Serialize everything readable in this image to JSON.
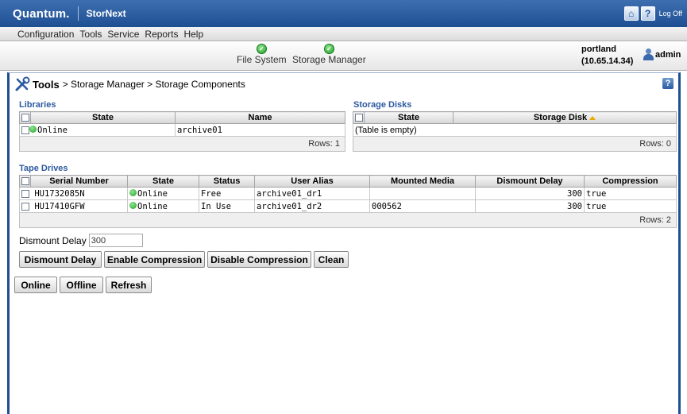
{
  "header": {
    "logo": "Quantum.",
    "product": "StorNext",
    "logoff_label": "Log Off"
  },
  "menu": [
    "Configuration",
    "Tools",
    "Service",
    "Reports",
    "Help"
  ],
  "status": {
    "items": [
      {
        "label": "File System"
      },
      {
        "label": "Storage Manager"
      }
    ],
    "host_name": "portland",
    "host_ip": "(10.65.14.34)",
    "user": "admin"
  },
  "breadcrumb": {
    "root": "Tools",
    "rest": "> Storage Manager > Storage Components"
  },
  "libraries": {
    "title": "Libraries",
    "columns": [
      "State",
      "Name"
    ],
    "rows": [
      {
        "state": "Online",
        "name": "archive01"
      }
    ],
    "footer": "Rows: 1"
  },
  "storage_disks": {
    "title": "Storage Disks",
    "columns": [
      "State",
      "Storage Disk"
    ],
    "empty_text": "(Table is empty)",
    "footer": "Rows: 0"
  },
  "tape_drives": {
    "title": "Tape Drives",
    "columns": [
      "Serial Number",
      "State",
      "Status",
      "User Alias",
      "Mounted Media",
      "Dismount Delay",
      "Compression"
    ],
    "rows": [
      {
        "serial": "HU1732085N",
        "state": "Online",
        "status": "Free",
        "alias": "archive01_dr1",
        "media": "",
        "delay": "300",
        "compression": "true"
      },
      {
        "serial": "HU17410GFW",
        "state": "Online",
        "status": "In Use",
        "alias": "archive01_dr2",
        "media": "000562",
        "delay": "300",
        "compression": "true"
      }
    ],
    "footer": "Rows: 2"
  },
  "dismount_delay": {
    "label": "Dismount Delay",
    "value": "300"
  },
  "actions": {
    "dismount_delay": "Dismount Delay",
    "enable_compression": "Enable Compression",
    "disable_compression": "Disable Compression",
    "clean": "Clean",
    "online": "Online",
    "offline": "Offline",
    "refresh": "Refresh"
  }
}
